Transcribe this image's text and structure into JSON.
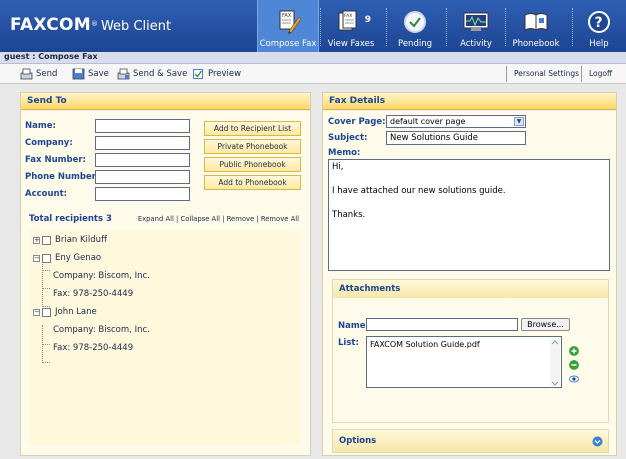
{
  "app": {
    "brand": "FAXCOM",
    "trademark": "®",
    "subtitle": "Web Client"
  },
  "nav": [
    {
      "label": "Compose Fax",
      "icon": "compose-fax-icon",
      "active": true
    },
    {
      "label": "View Faxes",
      "icon": "view-faxes-icon",
      "badge": "9"
    },
    {
      "label": "Pending",
      "icon": "pending-clock-icon"
    },
    {
      "label": "Activity",
      "icon": "activity-monitor-icon"
    },
    {
      "label": "Phonebook",
      "icon": "phonebook-icon"
    },
    {
      "label": "Help",
      "icon": "help-icon"
    }
  ],
  "breadcrumb": "guest : Compose Fax",
  "toolbar": {
    "send": "Send",
    "save": "Save",
    "send_save": "Send & Save",
    "preview": "Preview",
    "personal_settings": "Personal Settings",
    "logoff": "Logoff"
  },
  "send_to": {
    "title": "Send To",
    "fields": [
      {
        "label": "Name:",
        "value": ""
      },
      {
        "label": "Company:",
        "value": ""
      },
      {
        "label": "Fax Number:",
        "value": ""
      },
      {
        "label": "Phone Number:",
        "value": ""
      },
      {
        "label": "Account:",
        "value": ""
      }
    ],
    "buttons": [
      "Add to Recipient List",
      "Private Phonebook",
      "Public Phonebook",
      "Add to Phonebook"
    ],
    "total_label": "Total recipients 3",
    "links": [
      "Expand All",
      "Collapse All",
      "Remove",
      "Remove All"
    ],
    "recipients": [
      {
        "name": "Brian Kilduff",
        "expanded": false,
        "details": []
      },
      {
        "name": "Eny Genao",
        "expanded": true,
        "details": [
          "Company: Biscom, Inc.",
          "Fax: 978-250-4449"
        ]
      },
      {
        "name": "John Lane",
        "expanded": true,
        "details": [
          "Company: Biscom, Inc.",
          "Fax: 978-250-4449"
        ]
      }
    ]
  },
  "fax_details": {
    "title": "Fax Details",
    "cover_page_label": "Cover Page:",
    "cover_page_value": "default cover page",
    "subject_label": "Subject:",
    "subject_value": "New Solutions Guide",
    "memo_label": "Memo:",
    "memo_lines": [
      "Hi,",
      "",
      "I have attached our new solutions guide.",
      "",
      "Thanks."
    ]
  },
  "attachments": {
    "title": "Attachments",
    "name_label": "Name:",
    "name_value": "",
    "browse": "Browse...",
    "list_label": "List:",
    "files": [
      "FAXCOM Solution Guide.pdf"
    ]
  },
  "options": {
    "title": "Options"
  },
  "colors": {
    "header_blue": "#1d4593",
    "panel_yellow": "#ffd767",
    "label_blue": "#1d4593"
  }
}
